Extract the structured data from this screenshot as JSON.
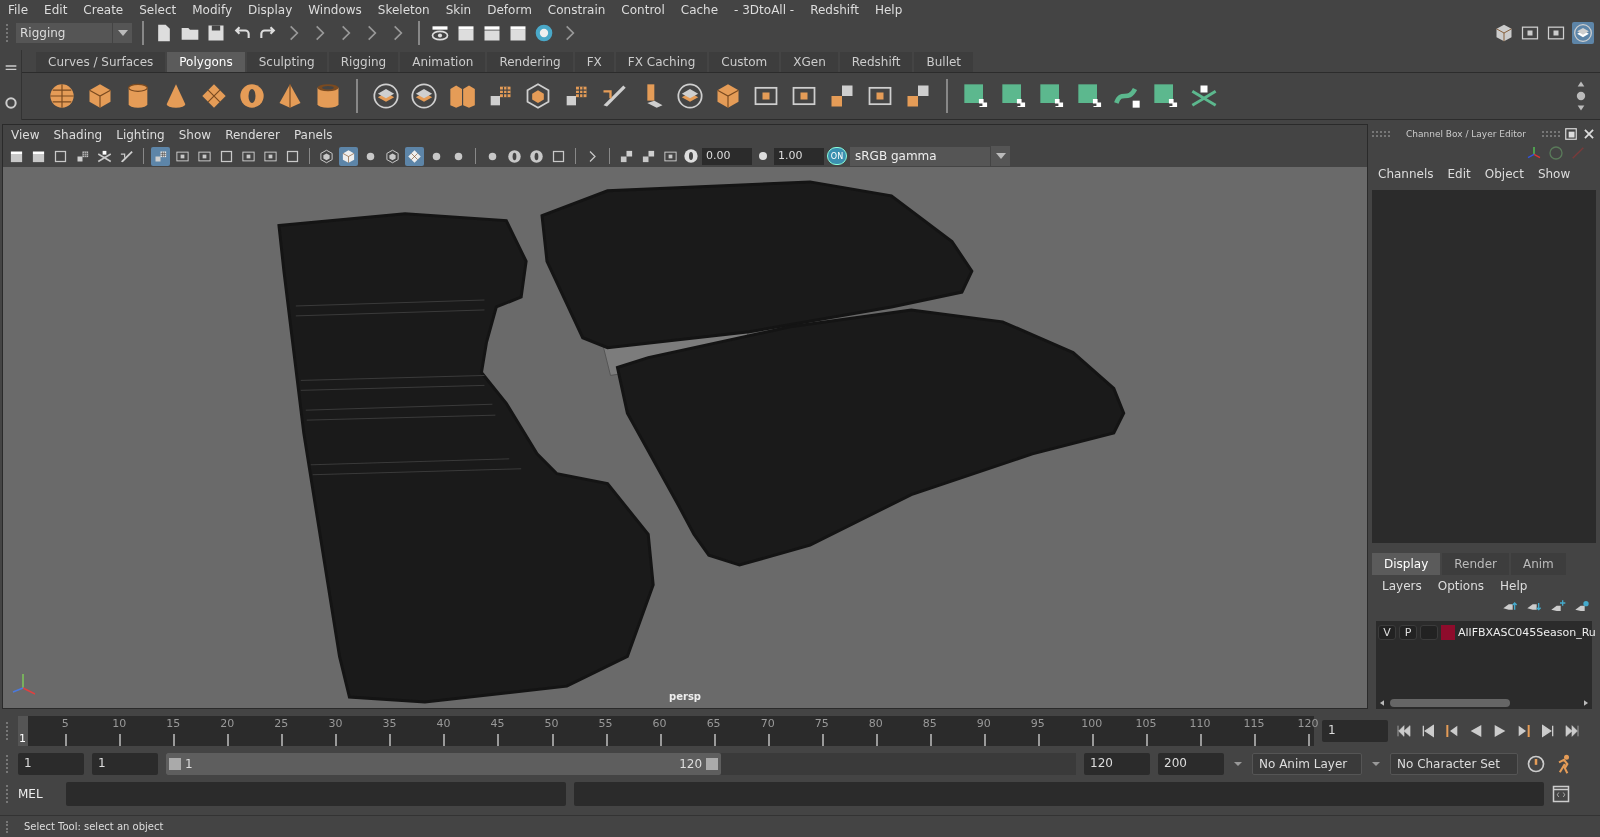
{
  "menubar": [
    "File",
    "Edit",
    "Create",
    "Select",
    "Modify",
    "Display",
    "Windows",
    "Skeleton",
    "Skin",
    "Deform",
    "Constrain",
    "Control",
    "Cache",
    "- 3DtoAll -",
    "Redshift",
    "Help"
  ],
  "status_line": {
    "workspace": "Rigging"
  },
  "shelf": {
    "tabs": [
      {
        "label": "Curves / Surfaces",
        "selected": false
      },
      {
        "label": "Polygons",
        "selected": true
      },
      {
        "label": "Sculpting",
        "selected": false
      },
      {
        "label": "Rigging",
        "selected": false
      },
      {
        "label": "Animation",
        "selected": false
      },
      {
        "label": "Rendering",
        "selected": false
      },
      {
        "label": "FX",
        "selected": false
      },
      {
        "label": "FX Caching",
        "selected": false
      },
      {
        "label": "Custom",
        "selected": false
      },
      {
        "label": "XGen",
        "selected": false
      },
      {
        "label": "Redshift",
        "selected": false
      },
      {
        "label": "Bullet",
        "selected": false
      }
    ]
  },
  "viewport": {
    "menu": [
      "View",
      "Shading",
      "Lighting",
      "Show",
      "Renderer",
      "Panels"
    ],
    "toolbar_buttons": [
      {
        "on": false
      },
      {
        "on": false
      },
      {
        "on": false
      },
      {
        "on": false
      },
      {
        "on": false
      },
      {
        "on": false
      },
      {
        "on": true
      },
      {
        "on": false
      },
      {
        "on": false
      },
      {
        "on": false
      },
      {
        "on": false
      },
      {
        "on": false
      },
      {
        "on": false
      },
      {
        "on": false
      },
      {
        "on": true
      },
      {
        "on": false
      },
      {
        "on": false
      },
      {
        "on": true
      },
      {
        "on": false
      },
      {
        "on": false
      },
      {
        "on": false
      },
      {
        "on": false
      },
      {
        "on": false
      },
      {
        "on": false
      },
      {
        "on": false
      },
      {
        "on": false
      },
      {
        "on": false
      },
      {
        "on": false
      }
    ],
    "exposure": "0.00",
    "gamma": "1.00",
    "color_management": {
      "label": "ON",
      "on": true
    },
    "color_space": "sRGB gamma",
    "camera": "persp"
  },
  "channel_box": {
    "title": "Channel Box / Layer Editor",
    "menu": [
      "Channels",
      "Edit",
      "Object",
      "Show"
    ],
    "layer_tabs": [
      {
        "label": "Display",
        "selected": true
      },
      {
        "label": "Render",
        "selected": false
      },
      {
        "label": "Anim",
        "selected": false
      }
    ],
    "layer_menu": [
      "Layers",
      "Options",
      "Help"
    ],
    "layers": [
      {
        "visibility": "V",
        "playback": "P",
        "color": "#8e0c2c",
        "name": "AllFBXASC045Season_Ru"
      }
    ]
  },
  "timeline": {
    "level": 0,
    "ticks": [
      "5",
      "10",
      "15",
      "20",
      "25",
      "30",
      "35",
      "40",
      "45",
      "50",
      "55",
      "60",
      "65",
      "70",
      "75",
      "80",
      "85",
      "90",
      "95",
      "100",
      "105",
      "110",
      "115",
      "120"
    ],
    "current_frame": "1",
    "current_frame_field": "1"
  },
  "range": {
    "level": 0.61,
    "start": "1",
    "playback_start": "1",
    "slider_start": "1",
    "slider_end": "120",
    "playback_end": "120",
    "end": "200",
    "anim_layer": "No Anim Layer",
    "character_set": "No Character Set"
  },
  "command_line": {
    "label": "MEL"
  },
  "help_line": "Select Tool: select an object"
}
